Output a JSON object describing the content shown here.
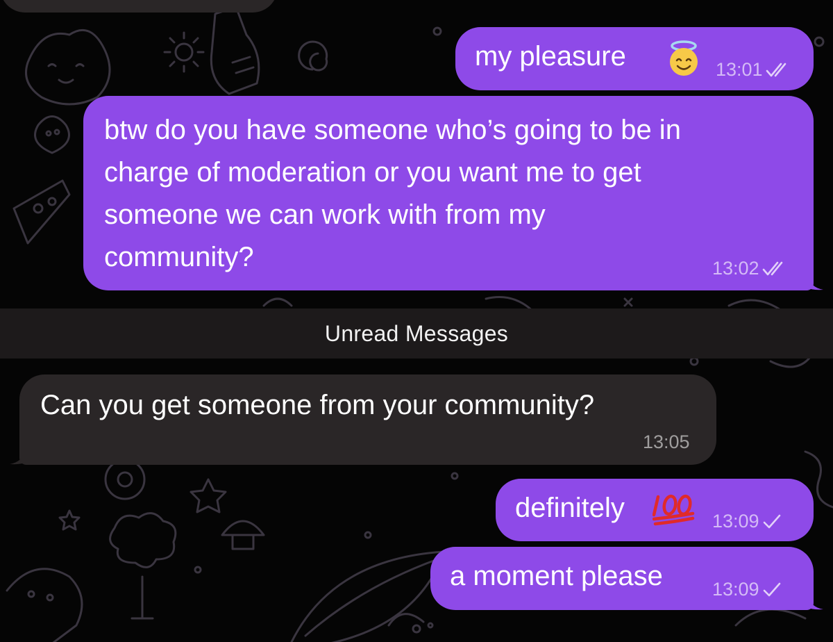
{
  "unread_divider": {
    "label": "Unread Messages"
  },
  "messages": [
    {
      "direction": "out",
      "text": "my pleasure",
      "emoji": "smiling-face-with-halo",
      "time": "13:01",
      "status": "read"
    },
    {
      "direction": "out",
      "lines": [
        "btw do you have someone who’s going to be in",
        "charge of moderation or you want me to get",
        "someone we can work with from my",
        "community?"
      ],
      "time": "13:02",
      "status": "read"
    },
    {
      "direction": "in",
      "text": "Can you get someone from your community?",
      "time": "13:05"
    },
    {
      "direction": "out",
      "text": "definitely",
      "emoji": "hundred-points",
      "time": "13:09",
      "status": "sent"
    },
    {
      "direction": "out",
      "text": "a moment please",
      "time": "13:09",
      "status": "sent"
    }
  ],
  "colors": {
    "outgoing_bubble": "#8e4ae8",
    "incoming_bubble": "#2a2627",
    "background": "#050505",
    "divider": "#1d1a1b"
  }
}
